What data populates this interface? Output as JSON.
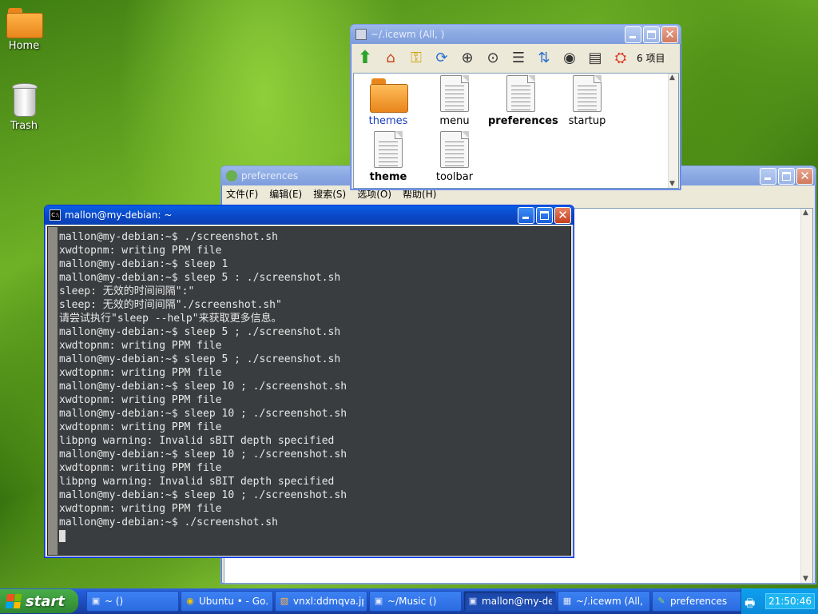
{
  "desktop": {
    "icons": [
      {
        "label": "Home",
        "icon": "folder-icon"
      },
      {
        "label": "Trash",
        "icon": "trash-icon"
      }
    ]
  },
  "file_manager": {
    "title": "~/.icewm (All, )",
    "item_count": "6 项目",
    "tools": [
      {
        "name": "up-arrow-icon",
        "glyph": "⬆"
      },
      {
        "name": "home-icon",
        "glyph": "⌂"
      },
      {
        "name": "bookmark-key-icon",
        "glyph": "⚿"
      },
      {
        "name": "refresh-icon",
        "glyph": "⟳"
      },
      {
        "name": "zoom-in-icon",
        "glyph": "⊕"
      },
      {
        "name": "zoom-fit-icon",
        "glyph": "⊙"
      },
      {
        "name": "list-view-icon",
        "glyph": "☰"
      },
      {
        "name": "sort-az-icon",
        "glyph": "⇅"
      },
      {
        "name": "eye-icon",
        "glyph": "◉"
      },
      {
        "name": "details-view-icon",
        "glyph": "▤"
      },
      {
        "name": "help-lifebuoy-icon",
        "glyph": "⛭"
      }
    ],
    "items": [
      {
        "label": "themes",
        "type": "folder",
        "style": "link"
      },
      {
        "label": "menu",
        "type": "file",
        "style": "normal"
      },
      {
        "label": "preferences",
        "type": "file",
        "style": "bold"
      },
      {
        "label": "startup",
        "type": "file",
        "style": "normal"
      },
      {
        "label": "theme",
        "type": "file",
        "style": "bold"
      },
      {
        "label": "toolbar",
        "type": "file",
        "style": "normal"
      }
    ]
  },
  "editor": {
    "title": "preferences",
    "menu": [
      "文件(F)",
      "编辑(E)",
      "搜索(S)",
      "选项(O)",
      "帮助(H)"
    ]
  },
  "terminal": {
    "title": "mallon@my-debian: ~",
    "lines": [
      "mallon@my-debian:~$ ./screenshot.sh",
      "xwdtopnm: writing PPM file",
      "mallon@my-debian:~$ sleep 1",
      "mallon@my-debian:~$ sleep 5 : ./screenshot.sh",
      "sleep: 无效的时间间隔\":\"",
      "sleep: 无效的时间间隔\"./screenshot.sh\"",
      "请尝试执行\"sleep --help\"来获取更多信息。",
      "mallon@my-debian:~$ sleep 5 ; ./screenshot.sh",
      "xwdtopnm: writing PPM file",
      "mallon@my-debian:~$ sleep 5 ; ./screenshot.sh",
      "xwdtopnm: writing PPM file",
      "mallon@my-debian:~$ sleep 10 ; ./screenshot.sh",
      "xwdtopnm: writing PPM file",
      "mallon@my-debian:~$ sleep 10 ; ./screenshot.sh",
      "xwdtopnm: writing PPM file",
      "libpng warning: Invalid sBIT depth specified",
      "mallon@my-debian:~$ sleep 10 ; ./screenshot.sh",
      "xwdtopnm: writing PPM file",
      "libpng warning: Invalid sBIT depth specified",
      "mallon@my-debian:~$ sleep 10 ; ./screenshot.sh",
      "xwdtopnm: writing PPM file",
      "mallon@my-debian:~$ ./screenshot.sh"
    ]
  },
  "taskbar": {
    "start_label": "start",
    "tasks": [
      {
        "label": "~ ()",
        "icon": "terminal-icon",
        "active": false
      },
      {
        "label": "Ubuntu • - Go...",
        "icon": "chrome-icon",
        "active": false
      },
      {
        "label": "vnxl:ddmqva.jp...",
        "icon": "image-viewer-icon",
        "active": false
      },
      {
        "label": "~/Music ()",
        "icon": "terminal-icon",
        "active": false
      },
      {
        "label": "mallon@my-de...",
        "icon": "terminal-icon",
        "active": true
      },
      {
        "label": "~/.icewm (All, )",
        "icon": "file-manager-icon",
        "active": false
      },
      {
        "label": "preferences",
        "icon": "editor-icon",
        "active": false
      }
    ],
    "clock": "21:50:46"
  }
}
